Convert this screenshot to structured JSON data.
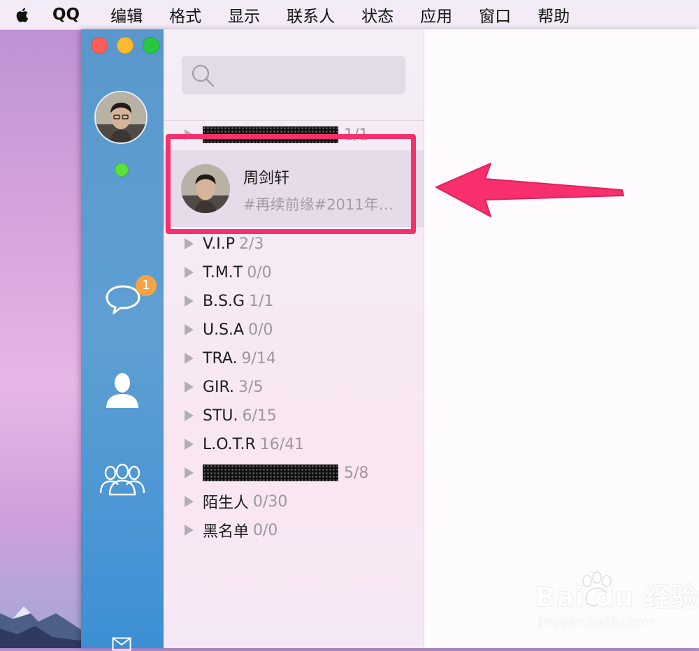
{
  "menubar": {
    "app_name": "QQ",
    "items": [
      "编辑",
      "格式",
      "显示",
      "联系人",
      "状态",
      "应用",
      "窗口",
      "帮助"
    ]
  },
  "sidebar": {
    "unread_badge": "1",
    "status_color": "#5be23a",
    "icons": [
      "chat-bubble-icon",
      "contact-icon",
      "group-icon",
      "mail-icon"
    ]
  },
  "search": {
    "placeholder": ""
  },
  "contact_list": {
    "top_group": {
      "count": "1/1",
      "name_redacted": true
    },
    "selected_contact": {
      "name": "周剑轩",
      "signature": "#再续前缘#2011年…"
    },
    "groups": [
      {
        "name": "V.I.P",
        "count": "2/3"
      },
      {
        "name": "T.M.T",
        "count": "0/0"
      },
      {
        "name": "B.S.G",
        "count": "1/1"
      },
      {
        "name": "U.S.A",
        "count": "0/0"
      },
      {
        "name": "TRA.",
        "count": "9/14"
      },
      {
        "name": "GIR.",
        "count": "3/5"
      },
      {
        "name": "STU.",
        "count": "6/15"
      },
      {
        "name": "L.O.T.R",
        "count": "16/41"
      },
      {
        "name": "",
        "count": "5/8",
        "redacted": true
      },
      {
        "name": "陌生人",
        "count": "0/30"
      },
      {
        "name": "黑名单",
        "count": "0/0"
      }
    ]
  },
  "annotation": {
    "color": "#f72f6c"
  },
  "watermark": {
    "logo": "Bai du 经验",
    "url": "jingyan.baidu.com"
  }
}
